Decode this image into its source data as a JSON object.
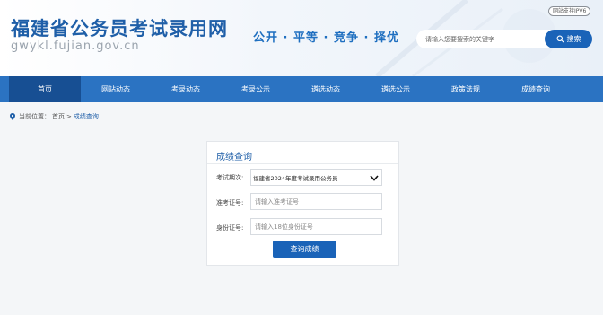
{
  "header": {
    "site_title": "福建省公务员考试录用网",
    "site_domain": "gwykl.fujian.gov.cn",
    "slogan": "公开 · 平等 · 竞争 · 择优",
    "ipv6_badge": "网站支持IPV6",
    "search_placeholder": "请输入您要搜索的关键字",
    "search_button": "搜索",
    "search_icon": "search-icon"
  },
  "nav": {
    "items": [
      {
        "label": "首页",
        "active": true
      },
      {
        "label": "网站动态"
      },
      {
        "label": "考录动态"
      },
      {
        "label": "考录公示"
      },
      {
        "label": "遴选动态"
      },
      {
        "label": "遴选公示"
      },
      {
        "label": "政策法规"
      },
      {
        "label": "成绩查询"
      }
    ]
  },
  "breadcrumb": {
    "icon": "location-pin-icon",
    "prefix": "当前位置：",
    "home": "首页",
    "separator": ">",
    "current": "成绩查询"
  },
  "form": {
    "title": "成绩查询",
    "exam_label": "考试期次:",
    "exam_value": "福建省2024年度考试录用公务员",
    "exam_icon": "chevron-down-icon",
    "admission_label": "准考证号:",
    "admission_placeholder": "请输入准考证号",
    "id_label": "身份证号:",
    "id_placeholder": "请输入18位身份证号",
    "submit": "查询成绩"
  },
  "colors": {
    "brand_blue": "#1f5fa8",
    "nav_blue": "#2b73c2",
    "nav_active": "#174f93",
    "button_blue": "#1a63b8"
  }
}
